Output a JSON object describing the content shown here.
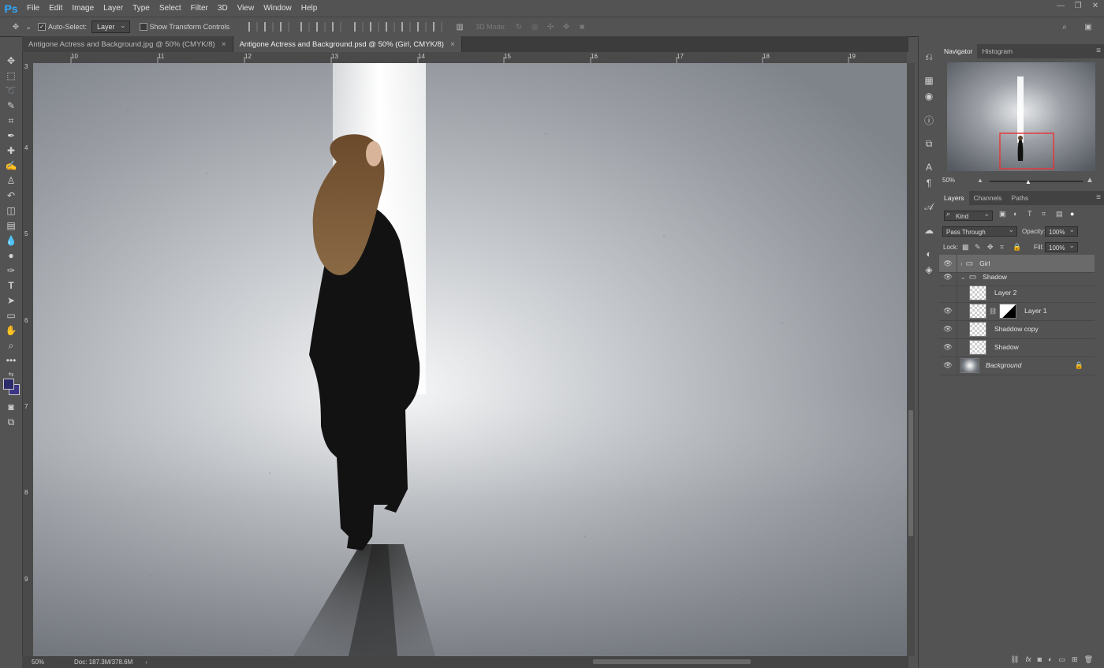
{
  "app": {
    "logo": "Ps"
  },
  "menu": [
    "File",
    "Edit",
    "Image",
    "Layer",
    "Type",
    "Select",
    "Filter",
    "3D",
    "View",
    "Window",
    "Help"
  ],
  "window_controls": [
    "—",
    "❐",
    "✕"
  ],
  "options": {
    "auto_select_label": "Auto-Select:",
    "auto_select_checked": true,
    "auto_select_target": "Layer",
    "show_transform_label": "Show Transform Controls",
    "show_transform_checked": false,
    "mode_3d_label": "3D Mode:"
  },
  "tabs": [
    {
      "label": "Antigone Actress and Background.jpg @ 50% (CMYK/8)",
      "active": false,
      "close": "×"
    },
    {
      "label": "Antigone Actress and Background.psd @ 50% (Girl, CMYK/8)",
      "active": true,
      "close": "×"
    }
  ],
  "ruler": {
    "h": [
      "10",
      "11",
      "12",
      "13",
      "14",
      "15",
      "16",
      "17",
      "18",
      "19"
    ],
    "v": [
      "3",
      "4",
      "5",
      "6",
      "7",
      "8",
      "9"
    ]
  },
  "status": {
    "zoom": "50%",
    "doc": "Doc: 187.3M/378.6M"
  },
  "navigator": {
    "tabs": [
      "Navigator",
      "Histogram"
    ],
    "zoom": "50%"
  },
  "layers_panel": {
    "tabs": [
      "Layers",
      "Channels",
      "Paths"
    ],
    "filter_kind": "Kind",
    "blend_mode": "Pass Through",
    "opacity_label": "Opacity:",
    "opacity": "100%",
    "lock_label": "Lock:",
    "fill_label": "Fill:",
    "fill": "100%",
    "layers": [
      {
        "name": "Girl",
        "type": "group",
        "visible": true,
        "expanded": false,
        "selected": true
      },
      {
        "name": "Shadow",
        "type": "group",
        "visible": true,
        "expanded": true
      },
      {
        "name": "Layer 2",
        "type": "layer",
        "visible": false
      },
      {
        "name": "Layer 1",
        "type": "layer-mask",
        "visible": true
      },
      {
        "name": "Shaddow copy",
        "type": "layer",
        "visible": true
      },
      {
        "name": "Shadow",
        "type": "layer",
        "visible": true
      },
      {
        "name": "Background",
        "type": "background",
        "visible": true,
        "locked": true
      }
    ]
  },
  "colors": {
    "foreground": "#2e2b6b",
    "background": "#3b3585",
    "nav_box": "#e23a3a"
  }
}
